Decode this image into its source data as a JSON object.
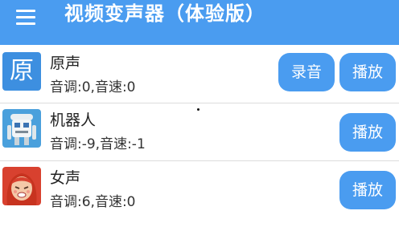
{
  "app": {
    "title": "视频变声器（体验版）"
  },
  "voices": [
    {
      "icon": "text-avatar",
      "avatar_text": "原",
      "name": "原声",
      "params": "音调:0,音速:0",
      "record_label": "录音",
      "play_label": "播放"
    },
    {
      "icon": "robot-icon",
      "name": "机器人",
      "params": "音调:-9,音速:-1",
      "play_label": "播放"
    },
    {
      "icon": "woman-face-icon",
      "name": "女声",
      "params": "音调:6,音速:0",
      "play_label": "播放"
    }
  ],
  "colors": {
    "accent": "#4a9cf0",
    "avatar_blue": "#3d8fe0",
    "divider": "#dcdcdc"
  }
}
